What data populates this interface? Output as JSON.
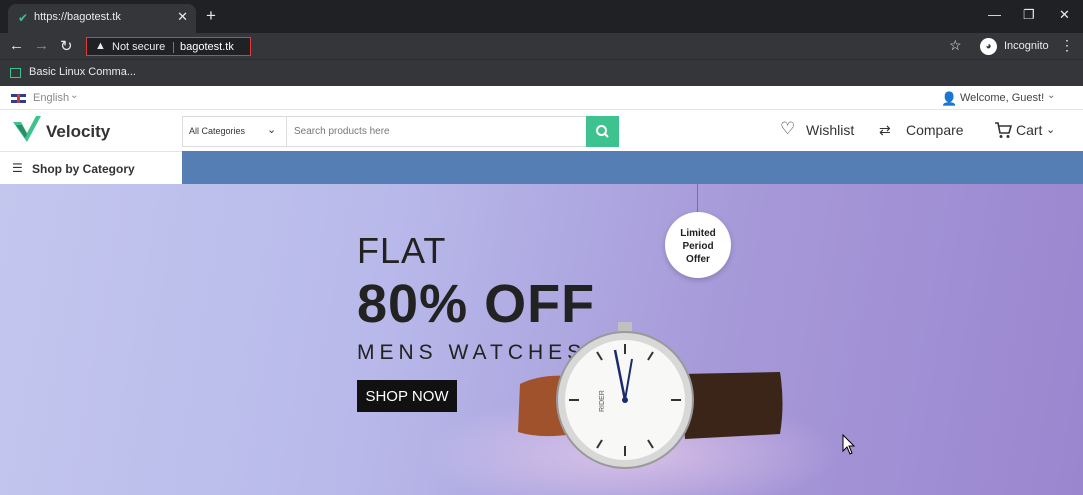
{
  "browser": {
    "tab_title": "https://bagotest.tk",
    "security_label": "Not secure",
    "url": "bagotest.tk",
    "profile_label": "Incognito",
    "bookmark_label": "Basic Linux Comma..."
  },
  "site": {
    "language": "English",
    "welcome": "Welcome, Guest!",
    "logo": "Velocity",
    "category_select": "All Categories",
    "search_placeholder": "Search products here",
    "wishlist": "Wishlist",
    "compare": "Compare",
    "cart": "Cart",
    "shop_by_category": "Shop by Category"
  },
  "hero": {
    "line1": "FLAT",
    "line2": "80% OFF",
    "line3": "MENS WATCHES",
    "cta": "SHOP NOW",
    "tag_line1": "Limited",
    "tag_line2": "Period",
    "tag_line3": "Offer",
    "watch_brand": "RIDER"
  },
  "colors": {
    "accent": "#3ec28f",
    "category_bar": "#557eb4",
    "url_highlight": "#e23a3a"
  }
}
